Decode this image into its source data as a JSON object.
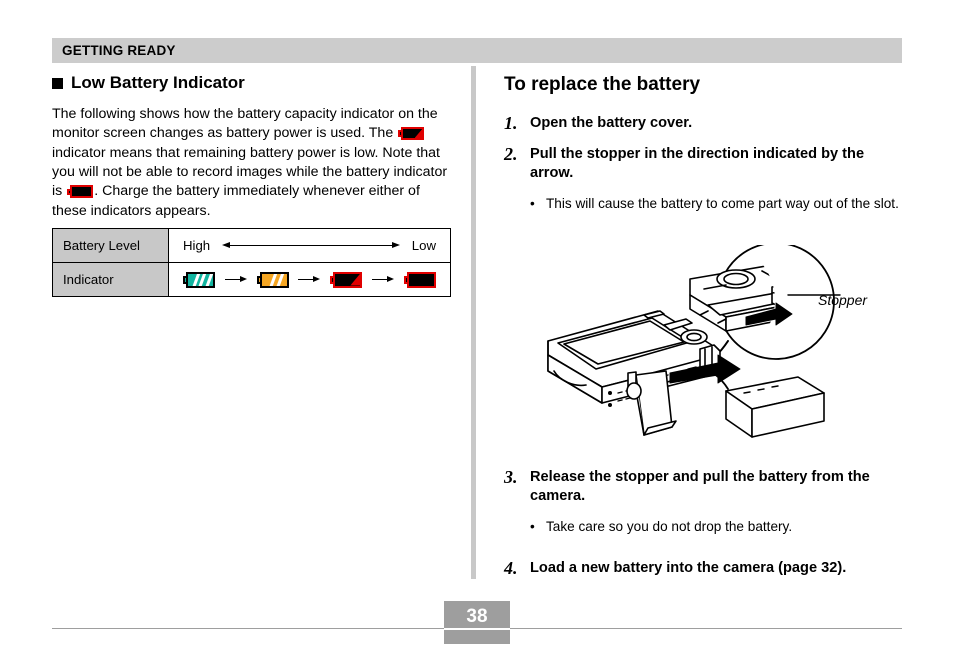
{
  "header": {
    "title": "GETTING READY"
  },
  "left": {
    "section_heading": "Low Battery Indicator",
    "paragraph_part1": "The following shows how the battery capacity indicator on the monitor screen changes as battery power is used. The",
    "paragraph_part2": "indicator means that remaining battery power is low. Note that you will not be able to record images while the battery indicator is",
    "paragraph_part3": ". Charge the battery immediately whenever either of these indicators appears.",
    "table": {
      "row_level_label": "Battery Level",
      "row_indicator_label": "Indicator",
      "level_high": "High",
      "level_low": "Low",
      "indicators": [
        "battery-full-green-icon",
        "battery-medium-orange-icon",
        "battery-low-red-icon",
        "battery-empty-red-icon"
      ],
      "arrow": "right-arrow-icon",
      "level_arrow": "double-headed-arrow-icon"
    }
  },
  "right": {
    "procedure_heading": "To replace the battery",
    "steps": [
      {
        "number": "1.",
        "text": "Open the battery cover.",
        "bullets": []
      },
      {
        "number": "2.",
        "text": "Pull the stopper in the direction indicated by the arrow.",
        "bullets": [
          {
            "dot": "•",
            "text": "This will cause the battery to come part way out of the slot."
          }
        ]
      },
      {
        "number": "3.",
        "text": "Release the stopper and pull the battery from the camera.",
        "bullets": [
          {
            "dot": "•",
            "text": "Take care so you do not drop the battery."
          }
        ]
      },
      {
        "number": "4.",
        "text": "Load a new battery into the camera (page 32).",
        "bullets": []
      }
    ],
    "figure": {
      "name": "camera-battery-removal-illustration",
      "callout_label": "Stopper"
    }
  },
  "footer": {
    "page_number": "38"
  },
  "colors": {
    "header_gray": "#cccccc",
    "table_label_gray": "#c8c8c8",
    "divider_gray": "#c8c8c8",
    "footer_gray": "#9e9e9e",
    "battery_green": "#11b5a0",
    "battery_orange": "#f5a623",
    "battery_red": "#e00000"
  }
}
